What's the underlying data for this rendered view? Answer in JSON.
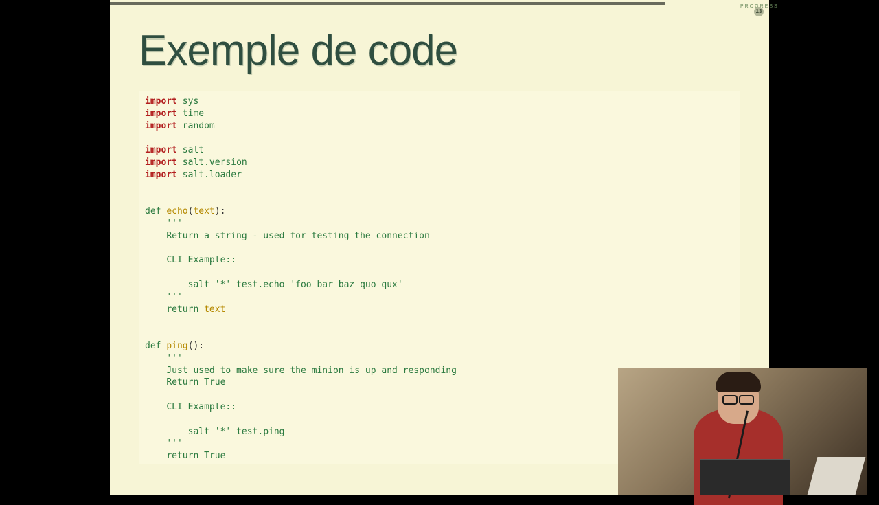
{
  "progress_label": "PROGRESS",
  "slide_number": "13",
  "title": "Exemple de code",
  "code": {
    "imports_a": [
      "sys",
      "time",
      "random"
    ],
    "imports_b": [
      "salt",
      "salt.version",
      "salt.loader"
    ],
    "kw_import": "import",
    "kw_def": "def",
    "kw_return": "return",
    "fn_echo": "echo",
    "arg_text": "text",
    "fn_ping": "ping",
    "doc_quote": "'''",
    "echo_doc_l1": "Return a string - used for testing the connection",
    "cli_header": "CLI Example::",
    "echo_cli": "salt '*' test.echo 'foo bar baz quo qux'",
    "echo_ret": "text",
    "ping_doc_l1": "Just used to make sure the minion is up and responding",
    "ping_doc_l2": "Return True",
    "ping_cli": "salt '*' test.ping",
    "ping_ret": "True"
  }
}
